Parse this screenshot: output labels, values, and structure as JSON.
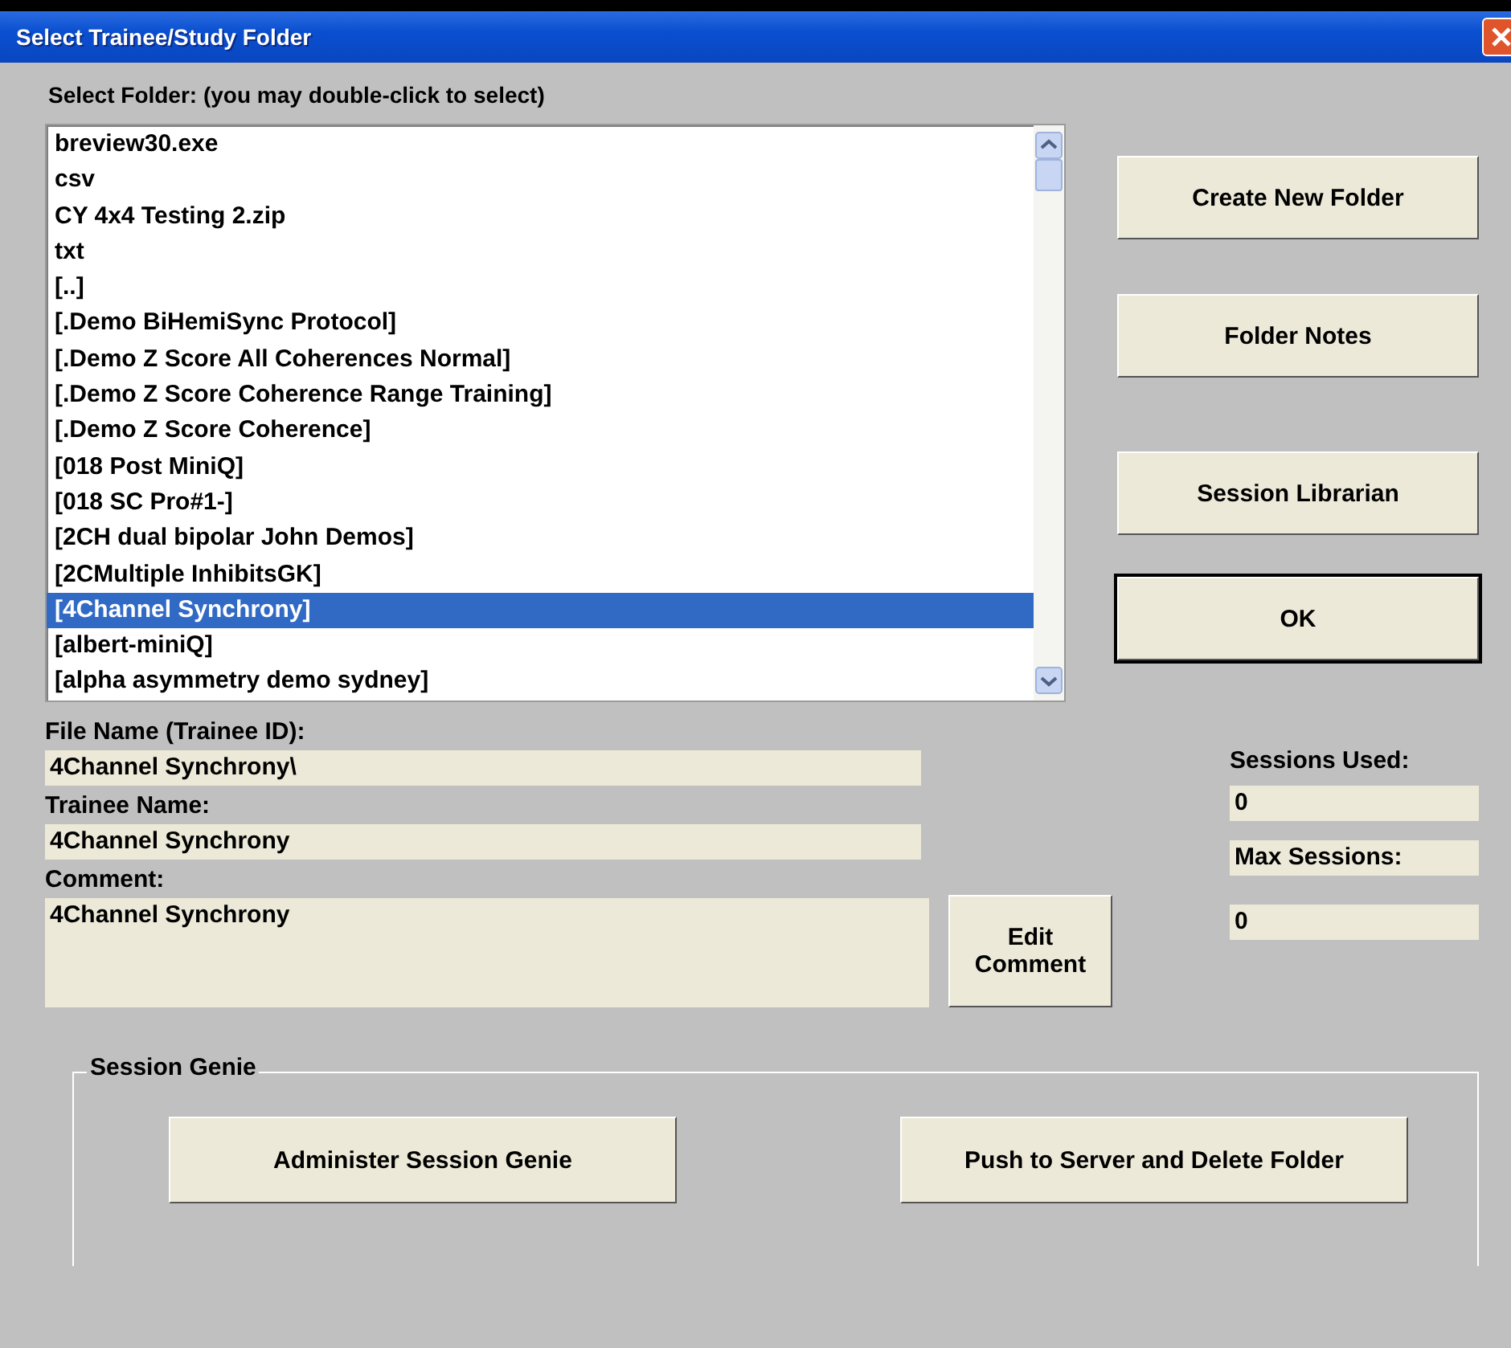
{
  "window": {
    "title": "Select Trainee/Study Folder"
  },
  "folder_list": {
    "label": "Select Folder: (you may double-click to select)",
    "items": [
      {
        "label": "breview30.exe",
        "selected": false
      },
      {
        "label": "csv",
        "selected": false
      },
      {
        "label": "CY 4x4 Testing 2.zip",
        "selected": false
      },
      {
        "label": "txt",
        "selected": false
      },
      {
        "label": "[..]",
        "selected": false
      },
      {
        "label": "[.Demo BiHemiSync Protocol]",
        "selected": false
      },
      {
        "label": "[.Demo Z Score All Coherences Normal]",
        "selected": false
      },
      {
        "label": "[.Demo Z Score Coherence Range Training]",
        "selected": false
      },
      {
        "label": "[.Demo Z Score Coherence]",
        "selected": false
      },
      {
        "label": "[018 Post MiniQ]",
        "selected": false
      },
      {
        "label": "[018 SC Pro#1-]",
        "selected": false
      },
      {
        "label": "[2CH dual bipolar John Demos]",
        "selected": false
      },
      {
        "label": "[2CMultiple InhibitsGK]",
        "selected": false
      },
      {
        "label": "[4Channel Synchrony]",
        "selected": true
      },
      {
        "label": "[albert-miniQ]",
        "selected": false
      },
      {
        "label": "[alpha asymmetry demo sydney]",
        "selected": false
      }
    ]
  },
  "side_buttons": [
    {
      "label": "Create New Folder",
      "default": false
    },
    {
      "label": "Folder Notes",
      "default": false
    },
    {
      "label": "Session Librarian",
      "default": false
    },
    {
      "label": "OK",
      "default": true
    }
  ],
  "file_name": {
    "label": "File Name (Trainee ID):",
    "value": "4Channel Synchrony\\"
  },
  "trainee_name": {
    "label": "Trainee Name:",
    "value": "4Channel Synchrony"
  },
  "comment": {
    "label": "Comment:",
    "value": "4Channel Synchrony",
    "button": "Edit Comment"
  },
  "sessions_used": {
    "label": "Sessions Used:",
    "value": "0"
  },
  "max_sessions": {
    "label": "Max Sessions:",
    "value": "0"
  },
  "session_genie": {
    "title": "Session Genie",
    "buttons": [
      "Administer Session Genie",
      "Push to Server and Delete Folder"
    ]
  }
}
